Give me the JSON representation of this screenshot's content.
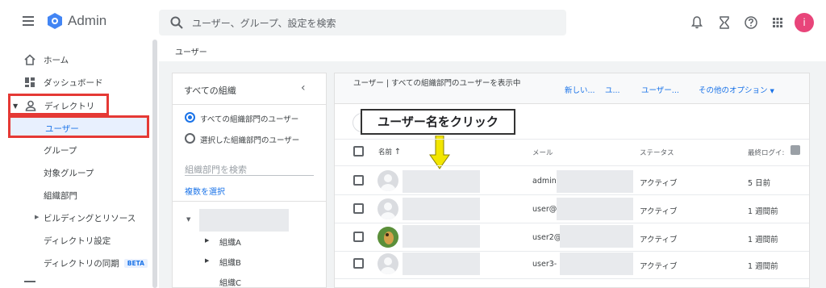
{
  "app": {
    "brand": "Admin"
  },
  "search": {
    "placeholder": "ユーザー、グループ、設定を検索"
  },
  "account": {
    "initial": "i"
  },
  "colors": {
    "accent": "#1a73e8",
    "highlight_border": "#e53935",
    "avatar": "#e8457a",
    "arrow": "#f2e600"
  },
  "sidebar": {
    "items": [
      {
        "label": "ホーム",
        "icon": "home-icon"
      },
      {
        "label": "ダッシュボード",
        "icon": "dashboard-icon"
      },
      {
        "label": "ディレクトリ",
        "icon": "person-icon"
      },
      {
        "label": "ユーザー"
      },
      {
        "label": "グループ"
      },
      {
        "label": "対象グループ"
      },
      {
        "label": "組織部門"
      },
      {
        "label": "ビルディングとリソース"
      },
      {
        "label": "ディレクトリ設定"
      },
      {
        "label": "ディレクトリの同期",
        "badge": "BETA"
      }
    ]
  },
  "breadcrumb": "ユーザー",
  "org_panel": {
    "title": "すべての組織",
    "radio_all": "すべての組織部門のユーザー",
    "radio_selected": "選択した組織部門のユーザー",
    "search_placeholder": "組織部門を検索",
    "multi_select": "複数を選択",
    "tree": [
      "組織A",
      "組織B",
      "組織C"
    ]
  },
  "user_panel": {
    "header_title": "ユーザー | すべての組織部門のユーザーを表示中",
    "actions": [
      "新しい...",
      "ユ...",
      "ユーザー...",
      "その他のオプション"
    ],
    "callout": "ユーザー名をクリック",
    "columns": {
      "name": "名前",
      "email": "メール",
      "status": "ステータス",
      "last_login": "最終ログイ:"
    },
    "rows": [
      {
        "email": "admin",
        "status": "アクティブ",
        "last_login": "5 日前"
      },
      {
        "email": "user@",
        "status": "アクティブ",
        "last_login": "1 週間前"
      },
      {
        "email": "user2@",
        "status": "アクティブ",
        "last_login": "1 週間前"
      },
      {
        "email": "user3-",
        "status": "アクティブ",
        "last_login": "1 週間前"
      }
    ]
  }
}
